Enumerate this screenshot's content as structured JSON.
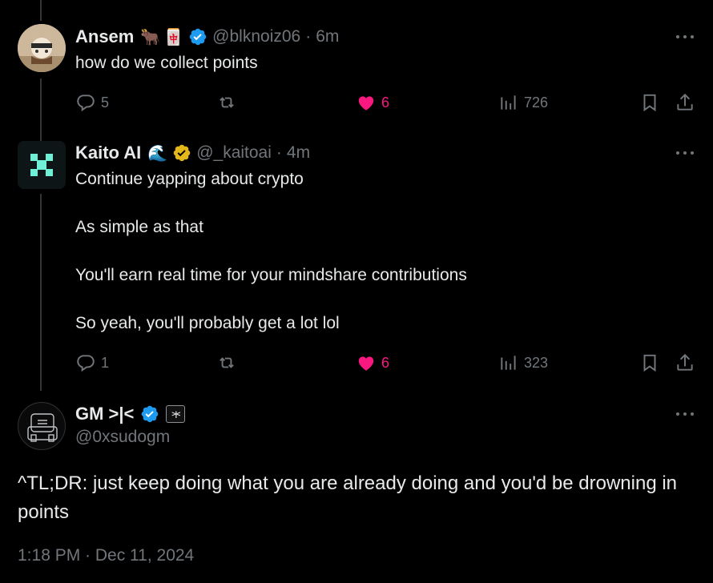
{
  "tweet1": {
    "name": "Ansem",
    "emoji_ox": "🐂",
    "emoji_mahjong": "🀄",
    "handle": "@blknoiz06",
    "sep": "·",
    "time": "6m",
    "text": "how do we collect points",
    "replies": "5",
    "retweets": "",
    "likes": "6",
    "views": "726"
  },
  "tweet2": {
    "name": "Kaito AI",
    "emoji_wave": "🌊",
    "handle": "@_kaitoai",
    "sep": "·",
    "time": "4m",
    "text": "Continue yapping about crypto\n\nAs simple as that\n\nYou'll earn real time for your mindshare contributions\n\nSo yeah, you'll probably get a lot lol",
    "replies": "1",
    "retweets": "",
    "likes": "6",
    "views": "323"
  },
  "tweet3": {
    "name": "GM >|<",
    "handle": "@0xsudogm",
    "affiliate_badge_text": ">|<",
    "text": "^TL;DR: just keep doing what you are already doing and you'd be drowning in points",
    "timestamp": "1:18 PM · Dec 11, 2024"
  },
  "colors": {
    "background": "#000000",
    "text": "#e7e9ea",
    "muted": "#71767b",
    "like": "#f91880",
    "verified_blue": "#1d9bf0",
    "verified_gold": "#e2b719",
    "thread_line": "#333639"
  }
}
